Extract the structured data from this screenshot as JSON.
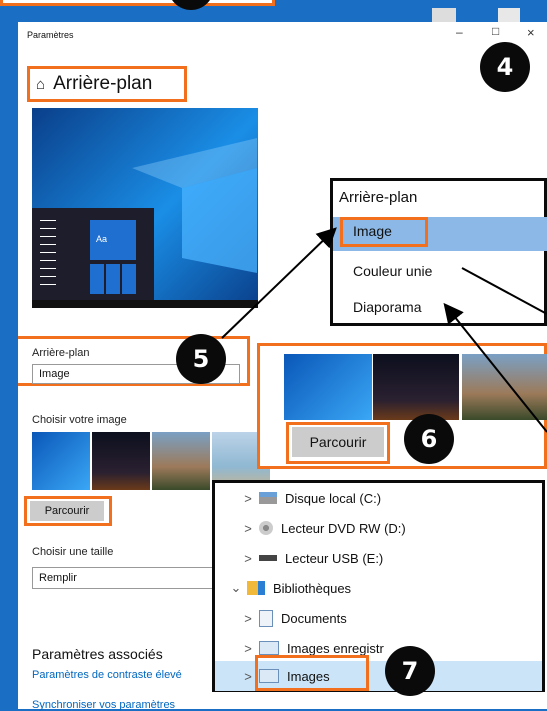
{
  "window": {
    "title": "Paramètres",
    "controls": [
      "–",
      "□",
      "×"
    ]
  },
  "header": {
    "title": "Arrière-plan"
  },
  "preview": {
    "tile_text": "Aa"
  },
  "background_section": {
    "label": "Arrière-plan",
    "selected": "Image"
  },
  "choose_image": {
    "label": "Choisir votre image",
    "browse": "Parcourir"
  },
  "fit": {
    "label": "Choisir une taille",
    "selected": "Remplir"
  },
  "related": {
    "title": "Paramètres associés",
    "links": [
      "Paramètres de contraste élevé",
      "Synchroniser vos paramètres"
    ]
  },
  "dropdown_callout": {
    "title": "Arrière-plan",
    "options": [
      "Image",
      "Couleur unie",
      "Diaporama"
    ]
  },
  "browse_callout": {
    "button": "Parcourir"
  },
  "explorer_callout": {
    "items": [
      {
        "label": "Disque local (C:)"
      },
      {
        "label": "Lecteur DVD RW (D:)"
      },
      {
        "label": "Lecteur USB (E:)"
      },
      {
        "label": "Bibliothèques"
      },
      {
        "label": "Documents"
      },
      {
        "label": "Images enregistr"
      },
      {
        "label": "Images"
      }
    ]
  },
  "steps": {
    "s4": "4",
    "s5": "5",
    "s6": "6",
    "s7": "7"
  },
  "colors": {
    "accent_orange": "#f26f1e",
    "windows_blue": "#0078d7",
    "link_blue": "#0067c0"
  }
}
